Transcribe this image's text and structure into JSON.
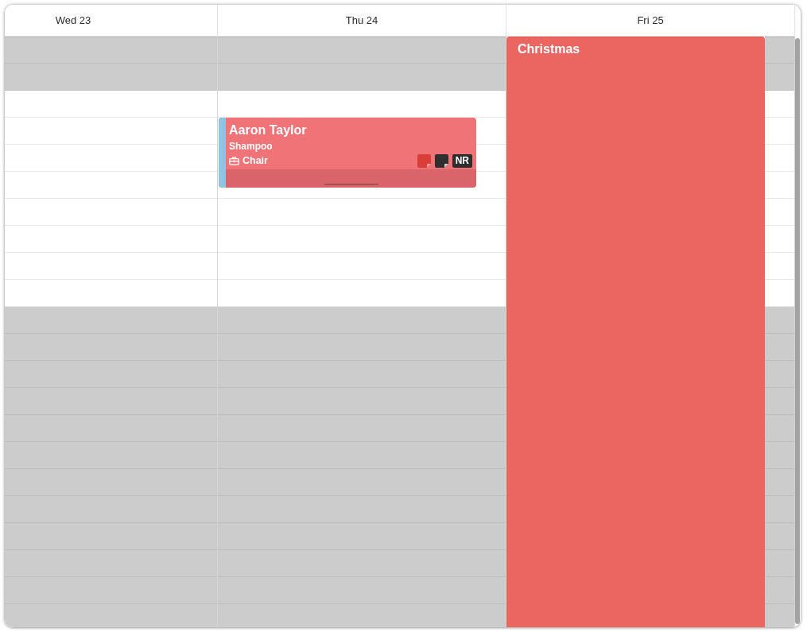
{
  "days": [
    {
      "label": "Wed 23"
    },
    {
      "label": "Thu 24",
      "events": [
        {
          "kind": "appointment",
          "client": "Aaron Taylor",
          "service": "Shampoo",
          "resource": "Chair",
          "badge": "NR"
        }
      ]
    },
    {
      "label": "Fri 25",
      "events": [
        {
          "kind": "all_day",
          "title": "Christmas"
        }
      ]
    }
  ],
  "rows": [
    {
      "unavailable": true
    },
    {
      "unavailable": true
    },
    {
      "unavailable": false
    },
    {
      "unavailable": false
    },
    {
      "unavailable": false
    },
    {
      "unavailable": false
    },
    {
      "unavailable": false
    },
    {
      "unavailable": false
    },
    {
      "unavailable": false
    },
    {
      "unavailable": false
    },
    {
      "unavailable": true
    },
    {
      "unavailable": true
    },
    {
      "unavailable": true
    },
    {
      "unavailable": true
    },
    {
      "unavailable": true
    },
    {
      "unavailable": true
    },
    {
      "unavailable": true
    },
    {
      "unavailable": true
    },
    {
      "unavailable": true
    },
    {
      "unavailable": true
    },
    {
      "unavailable": true
    },
    {
      "unavailable": true
    }
  ]
}
